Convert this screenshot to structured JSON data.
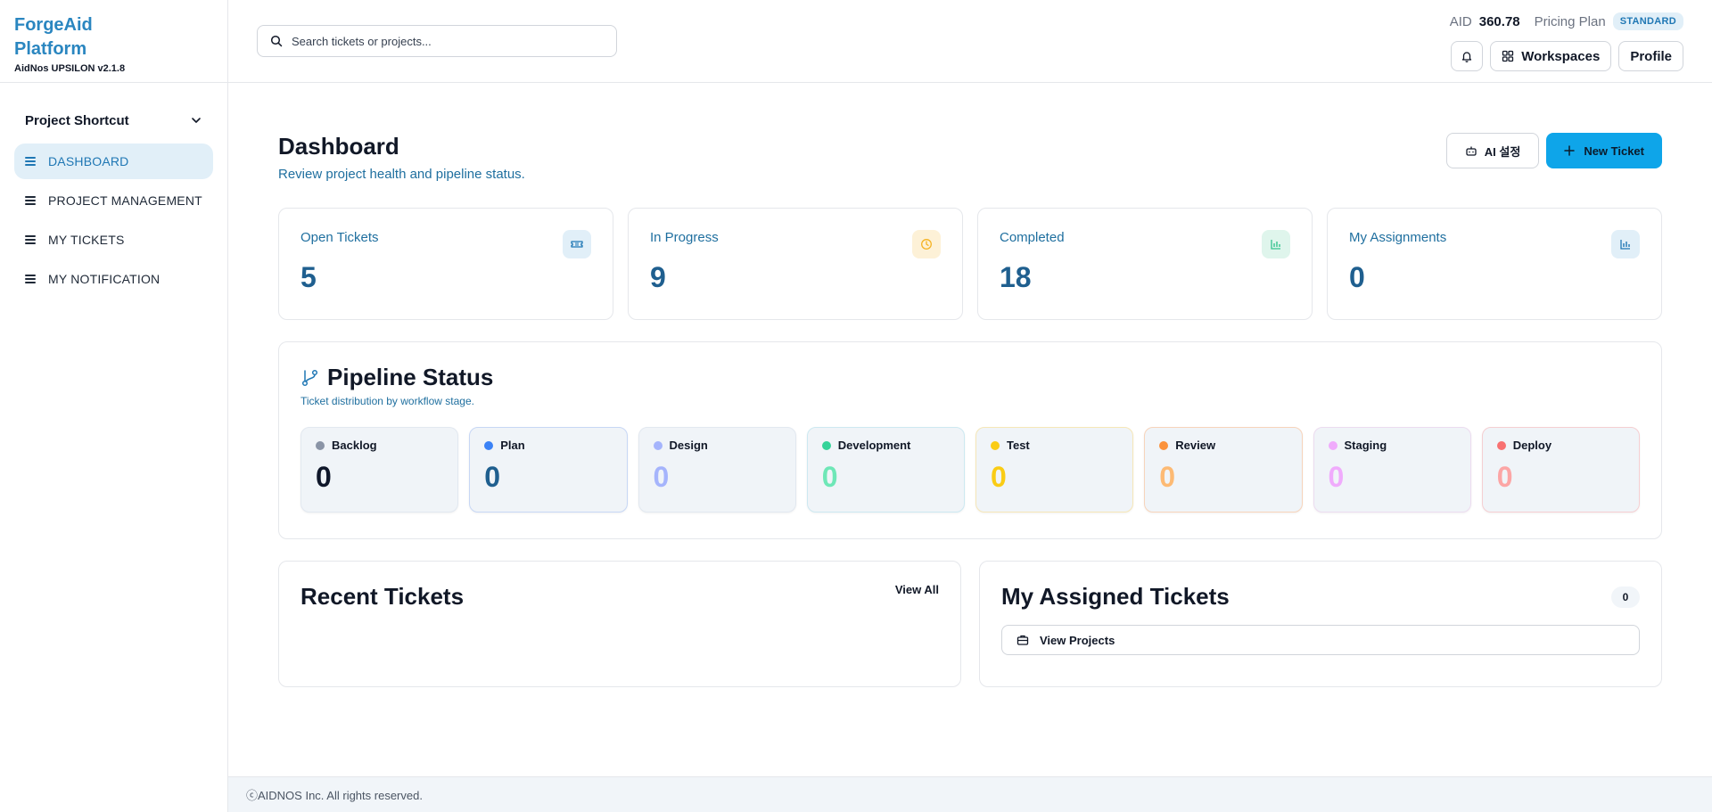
{
  "brand": {
    "line1": "ForgeAid",
    "line2": "Platform",
    "version": "AidNos UPSILON v2.1.8"
  },
  "sidebar": {
    "shortcut_label": "Project Shortcut",
    "items": [
      {
        "label": "DASHBOARD",
        "active": true
      },
      {
        "label": "PROJECT MANAGEMENT",
        "active": false
      },
      {
        "label": "MY TICKETS",
        "active": false
      },
      {
        "label": "MY NOTIFICATION",
        "active": false
      }
    ]
  },
  "header": {
    "search_placeholder": "Search tickets or projects...",
    "aid_label": "AID",
    "aid_value": "360.78",
    "plan_label": "Pricing Plan",
    "plan_badge": "STANDARD",
    "workspaces_label": "Workspaces",
    "profile_label": "Profile"
  },
  "page": {
    "title": "Dashboard",
    "subtitle": "Review project health and pipeline status.",
    "ai_button": "AI 설정",
    "new_ticket_button": "New Ticket"
  },
  "stats": [
    {
      "label": "Open Tickets",
      "value": "5",
      "icon": "ticket-icon",
      "icon_bg": "#e1eff8",
      "icon_color": "#1f77b4"
    },
    {
      "label": "In Progress",
      "value": "9",
      "icon": "clock-icon",
      "icon_bg": "#fdf1d7",
      "icon_color": "#f5b324"
    },
    {
      "label": "Completed",
      "value": "18",
      "icon": "bar-chart-icon",
      "icon_bg": "#dff5ec",
      "icon_color": "#34c38f"
    },
    {
      "label": "My Assignments",
      "value": "0",
      "icon": "bar-chart-icon",
      "icon_bg": "#e1eff8",
      "icon_color": "#1f77b4"
    }
  ],
  "pipeline": {
    "title": "Pipeline Status",
    "subtitle": "Ticket distribution by workflow stage.",
    "stages": [
      {
        "name": "Backlog",
        "value": "0",
        "dot": "#8a94a6",
        "color": "#0f172a",
        "border": "#e2e8f0"
      },
      {
        "name": "Plan",
        "value": "0",
        "dot": "#3b82f6",
        "color": "#1f5f8f",
        "border": "#c7d7f5"
      },
      {
        "name": "Design",
        "value": "0",
        "dot": "#a5b4fc",
        "color": "#a5b4fc",
        "border": "#e2e8f0"
      },
      {
        "name": "Development",
        "value": "0",
        "dot": "#34d399",
        "color": "#6ee7b7",
        "border": "#cde9f1"
      },
      {
        "name": "Test",
        "value": "0",
        "dot": "#facc15",
        "color": "#facc15",
        "border": "#f6e7b8"
      },
      {
        "name": "Review",
        "value": "0",
        "dot": "#fb923c",
        "color": "#fdba74",
        "border": "#f7d4bb"
      },
      {
        "name": "Staging",
        "value": "0",
        "dot": "#f0abfc",
        "color": "#f0abfc",
        "border": "#ecdcf0"
      },
      {
        "name": "Deploy",
        "value": "0",
        "dot": "#f87171",
        "color": "#fca5a5",
        "border": "#f5cfd2"
      }
    ]
  },
  "recent": {
    "title": "Recent Tickets",
    "view_all": "View All"
  },
  "assigned": {
    "title": "My Assigned Tickets",
    "count": "0",
    "view_projects": "View Projects"
  },
  "footer": {
    "text": "ⓒAIDNOS Inc. All rights reserved."
  }
}
